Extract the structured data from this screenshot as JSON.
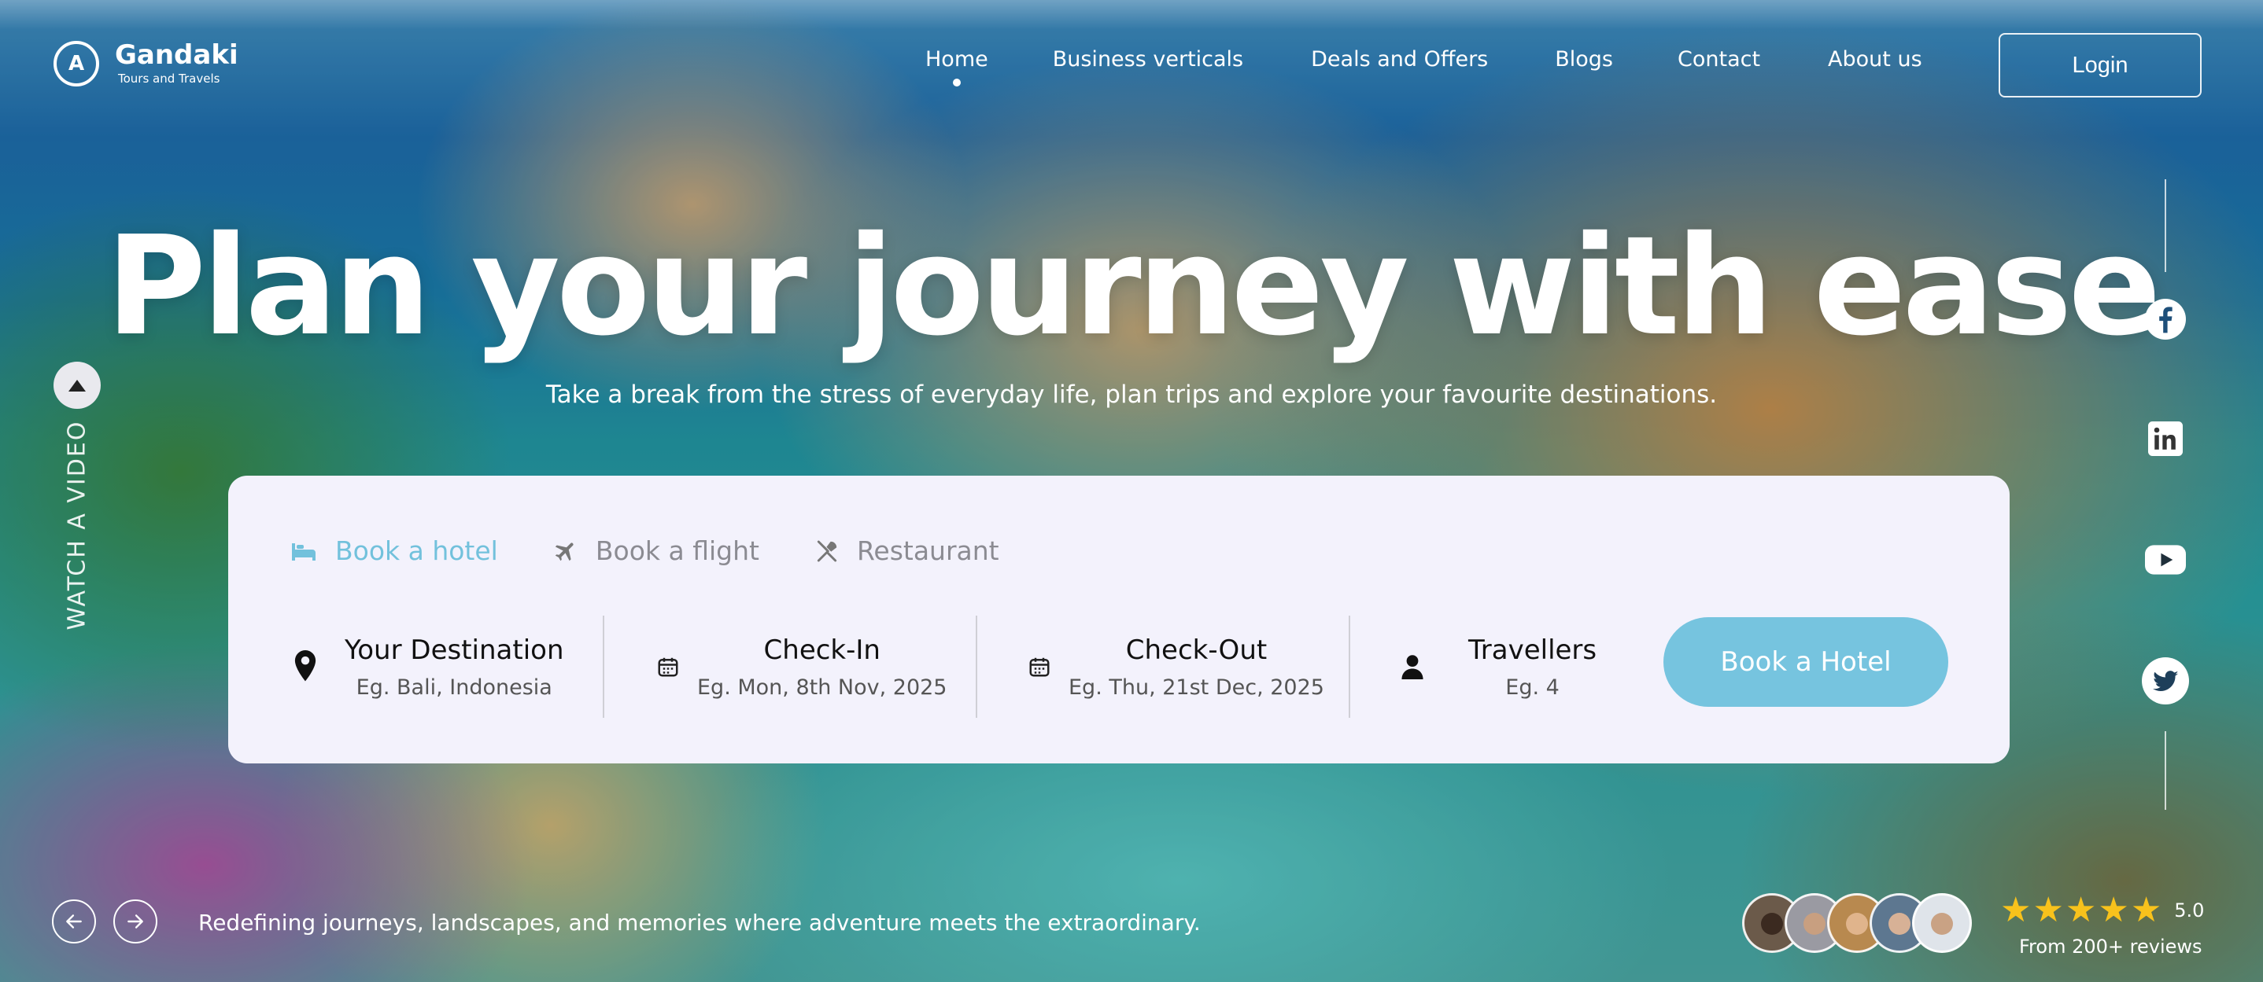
{
  "brand": {
    "name": "Gandaki",
    "tagline": "Tours and Travels",
    "logo_letter": "A"
  },
  "nav": {
    "items": [
      {
        "label": "Home",
        "active": true
      },
      {
        "label": "Business verticals"
      },
      {
        "label": "Deals and Offers"
      },
      {
        "label": "Blogs"
      },
      {
        "label": "Contact"
      },
      {
        "label": "About us"
      }
    ],
    "login_label": "Login"
  },
  "hero": {
    "title": "Plan your journey with ease",
    "subtitle": "Take a break from the stress of everyday life, plan trips and explore your favourite destinations."
  },
  "watch_video_label": "WATCH A VIDEO",
  "booking": {
    "tabs": [
      {
        "label": "Book a hotel",
        "icon": "bed-icon",
        "active": true
      },
      {
        "label": "Book a flight",
        "icon": "airplane-icon"
      },
      {
        "label": "Restaurant",
        "icon": "utensils-icon"
      }
    ],
    "fields": [
      {
        "label": "Your Destination",
        "placeholder": "Eg. Bali, Indonesia",
        "icon": "location-pin-icon"
      },
      {
        "label": "Check-In",
        "placeholder": "Eg. Mon, 8th Nov, 2025",
        "icon": "calendar-icon"
      },
      {
        "label": "Check-Out",
        "placeholder": "Eg. Thu, 21st Dec, 2025",
        "icon": "calendar-icon"
      },
      {
        "label": "Travellers",
        "placeholder": "Eg. 4",
        "icon": "person-icon"
      }
    ],
    "submit_label": "Book a Hotel"
  },
  "social": [
    "facebook-icon",
    "linkedin-icon",
    "youtube-icon",
    "twitter-icon"
  ],
  "footer": {
    "tagline": "Redefining journeys, landscapes, and memories where adventure meets the extraordinary.",
    "rating": "5.0",
    "stars": 5,
    "reviews": "From 200+ reviews"
  },
  "colors": {
    "accent": "#76c4df",
    "card_bg": "#f3f2fc",
    "star": "#f8c21c"
  }
}
